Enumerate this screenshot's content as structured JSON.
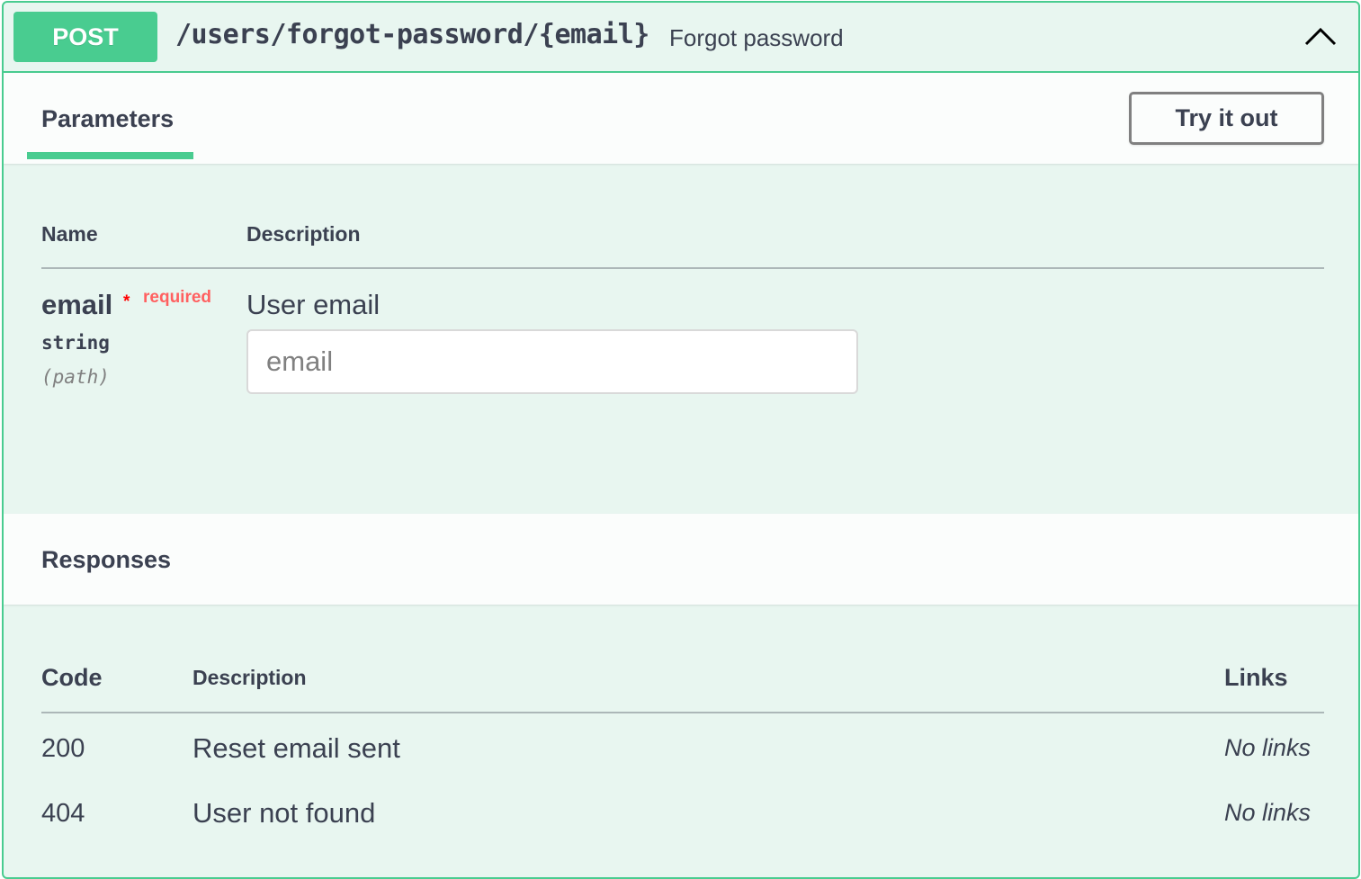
{
  "operation": {
    "method": "POST",
    "path": "/users/forgot-password/{email}",
    "summary": "Forgot password",
    "colors": {
      "accent": "#49cc90",
      "background": "#e8f6f0",
      "text": "#3b4151",
      "required": "#ff0000"
    }
  },
  "parameters": {
    "tab_label": "Parameters",
    "try_button": "Try it out",
    "columns": {
      "name": "Name",
      "description": "Description"
    },
    "items": [
      {
        "name": "email",
        "required_star": "*",
        "required_label": "required",
        "type": "string",
        "in": "(path)",
        "description": "User email",
        "placeholder": "email",
        "value": ""
      }
    ]
  },
  "responses": {
    "title": "Responses",
    "columns": {
      "code": "Code",
      "description": "Description",
      "links": "Links"
    },
    "rows": [
      {
        "code": "200",
        "description": "Reset email sent",
        "links": "No links"
      },
      {
        "code": "404",
        "description": "User not found",
        "links": "No links"
      }
    ]
  },
  "icons": {
    "collapse": "chevron-up-icon"
  }
}
